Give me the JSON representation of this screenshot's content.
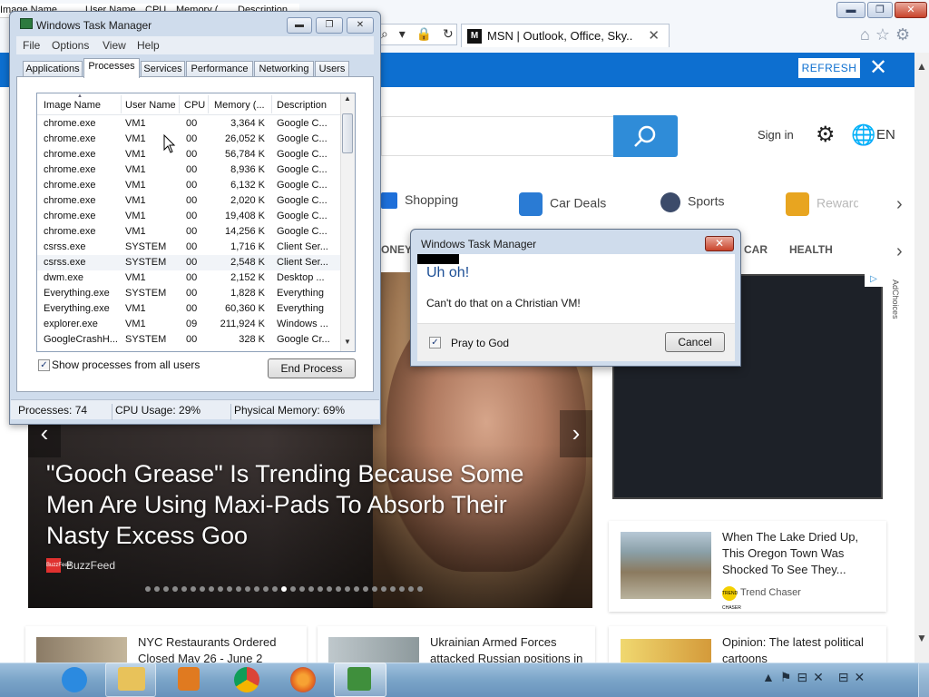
{
  "ie": {
    "tab_title": "MSN | Outlook, Office, Sky...",
    "tab_favicon": "M",
    "caption_min": "▬",
    "caption_max": "❐",
    "caption_close": "✕",
    "tab_close": "✕",
    "address_icons": "⌕ ▾ 🔒 ↻",
    "tool_icons": "⌂☆⚙"
  },
  "msn": {
    "refresh_label": "REFRESH",
    "banner_close": "✕",
    "sign_in": "Sign in",
    "language": "EN",
    "gear_icon": "⚙",
    "globe_icon": "🌐",
    "nav_items": [
      {
        "label": "Shopping",
        "icon_color": "#1e6fd9"
      },
      {
        "label": "Car Deals",
        "icon_color": "#2a7bd4"
      },
      {
        "label": "Sports",
        "icon_color": "#3c4b6a"
      },
      {
        "label": "Rewards",
        "icon_color": "#e8a520"
      }
    ],
    "nav_next": "›",
    "subnav_money": "ONEY",
    "subnav_car": "CAR",
    "subnav_health": "HEALTH",
    "subnav_next": "›",
    "hero": {
      "title": "\"Gooch Grease\" Is Trending Because Some Men Are Using Maxi-Pads To Absorb Their Nasty Excess Goo",
      "source": "BuzzFeed",
      "source_badge": "BuzzFeed",
      "prev": "‹",
      "next": "›",
      "dot_count": 31,
      "active_dot": 15
    },
    "ad_tag": "▷",
    "adchoices": "AdChoices",
    "cards": [
      {
        "title": "When The Lake Dried Up, This Oregon Town Was Shocked To See They...",
        "source": "Trend Chaser",
        "source_badge": "TREND CHASER"
      },
      {
        "title": "NYC Restaurants Ordered Closed May 26 - June 2"
      },
      {
        "title": "Ukrainian Armed Forces attacked Russian positions in"
      },
      {
        "title": "Opinion: The latest political cartoons"
      }
    ],
    "scroll_up": "▲",
    "scroll_down": "▼"
  },
  "bg_taskman_header": {
    "image_name": "Image Name",
    "user_name": "User Name",
    "cpu": "CPU",
    "memory": "Memory (...",
    "description": "Description"
  },
  "taskman": {
    "title": "Windows Task Manager",
    "min": "▬",
    "max": "❐",
    "close": "✕",
    "menu": [
      "File",
      "Options",
      "View",
      "Help"
    ],
    "tabs": [
      "Applications",
      "Processes",
      "Services",
      "Performance",
      "Networking",
      "Users"
    ],
    "active_tab": "Processes",
    "columns": [
      "Image Name",
      "User Name",
      "CPU",
      "Memory (...",
      "Description"
    ],
    "rows": [
      {
        "name": "chrome.exe",
        "user": "VM1",
        "cpu": "00",
        "mem": "3,364 K",
        "desc": "Google C..."
      },
      {
        "name": "chrome.exe",
        "user": "VM1",
        "cpu": "00",
        "mem": "26,052 K",
        "desc": "Google C..."
      },
      {
        "name": "chrome.exe",
        "user": "VM1",
        "cpu": "00",
        "mem": "56,784 K",
        "desc": "Google C..."
      },
      {
        "name": "chrome.exe",
        "user": "VM1",
        "cpu": "00",
        "mem": "8,936 K",
        "desc": "Google C..."
      },
      {
        "name": "chrome.exe",
        "user": "VM1",
        "cpu": "00",
        "mem": "6,132 K",
        "desc": "Google C..."
      },
      {
        "name": "chrome.exe",
        "user": "VM1",
        "cpu": "00",
        "mem": "2,020 K",
        "desc": "Google C..."
      },
      {
        "name": "chrome.exe",
        "user": "VM1",
        "cpu": "00",
        "mem": "19,408 K",
        "desc": "Google C..."
      },
      {
        "name": "chrome.exe",
        "user": "VM1",
        "cpu": "00",
        "mem": "14,256 K",
        "desc": "Google C..."
      },
      {
        "name": "csrss.exe",
        "user": "SYSTEM",
        "cpu": "00",
        "mem": "1,716 K",
        "desc": "Client Ser..."
      },
      {
        "name": "csrss.exe",
        "user": "SYSTEM",
        "cpu": "00",
        "mem": "2,548 K",
        "desc": "Client Ser..."
      },
      {
        "name": "dwm.exe",
        "user": "VM1",
        "cpu": "00",
        "mem": "2,152 K",
        "desc": "Desktop ..."
      },
      {
        "name": "Everything.exe",
        "user": "SYSTEM",
        "cpu": "00",
        "mem": "1,828 K",
        "desc": "Everything"
      },
      {
        "name": "Everything.exe",
        "user": "VM1",
        "cpu": "00",
        "mem": "60,360 K",
        "desc": "Everything"
      },
      {
        "name": "explorer.exe",
        "user": "VM1",
        "cpu": "09",
        "mem": "211,924 K",
        "desc": "Windows ..."
      },
      {
        "name": "GoogleCrashH...",
        "user": "SYSTEM",
        "cpu": "00",
        "mem": "328 K",
        "desc": "Google Cr..."
      }
    ],
    "selected_row": 9,
    "show_all_label": "Show processes from all users",
    "show_all_checked": "✓",
    "end_process": "End Process",
    "status_processes": "Processes: 74",
    "status_cpu": "CPU Usage: 29%",
    "status_mem": "Physical Memory: 69%",
    "scroll_up": "▲",
    "scroll_down": "▼"
  },
  "dialog": {
    "title": "Windows Task Manager",
    "close": "✕",
    "heading": "Uh oh!",
    "message": "Can't do that on a Christian VM!",
    "checkbox_label": "Pray to God",
    "checkbox_mark": "✓",
    "cancel": "Cancel"
  },
  "taskbar": {
    "tray_icons": "▲⚑⊟✕ ⊟✕",
    "apps": [
      {
        "name": "internet-explorer",
        "color": "#2b8ae0"
      },
      {
        "name": "file-explorer",
        "color": "#e8c25a"
      },
      {
        "name": "media-player",
        "color": "#e07a20"
      },
      {
        "name": "chrome",
        "color": "#db4437"
      },
      {
        "name": "firefox",
        "color": "#e66a1f"
      },
      {
        "name": "task-manager",
        "color": "#3f8f3c"
      }
    ]
  }
}
